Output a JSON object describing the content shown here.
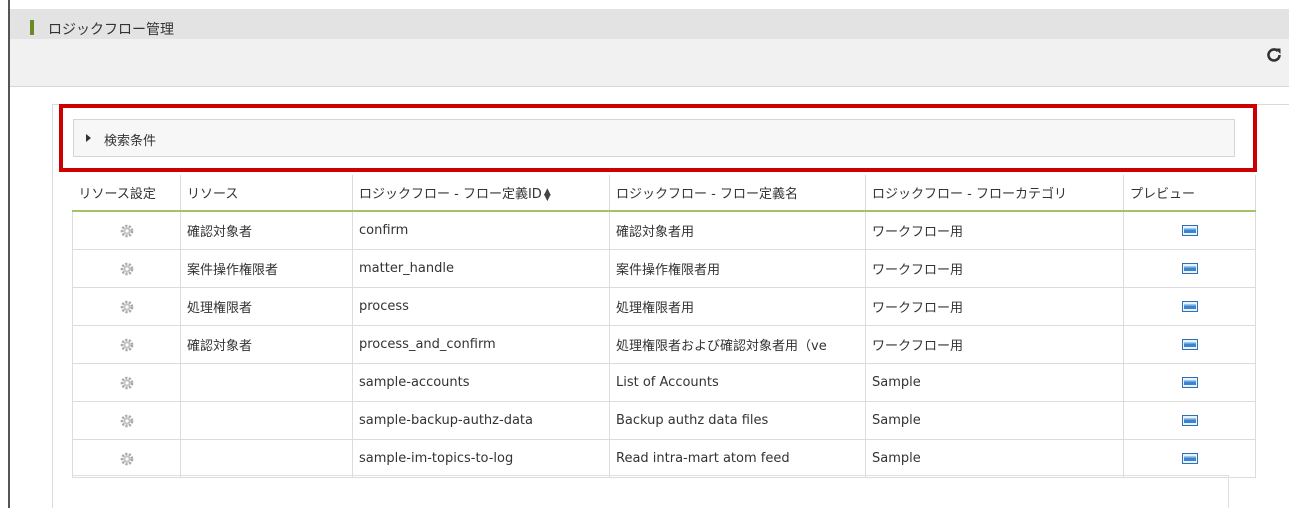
{
  "page": {
    "title": "ロジックフロー管理"
  },
  "search": {
    "label": "検索条件"
  },
  "table": {
    "headers": [
      "リソース設定",
      "リソース",
      "ロジックフロー - フロー定義ID",
      "ロジックフロー - フロー定義名",
      "ロジックフロー - フローカテゴリ",
      "プレビュー"
    ],
    "rows": [
      {
        "resource": "確認対象者",
        "flow_id": "confirm",
        "flow_name": "確認対象者用",
        "category": "ワークフロー用"
      },
      {
        "resource": "案件操作権限者",
        "flow_id": "matter_handle",
        "flow_name": "案件操作権限者用",
        "category": "ワークフロー用"
      },
      {
        "resource": "処理権限者",
        "flow_id": "process",
        "flow_name": "処理権限者用",
        "category": "ワークフロー用"
      },
      {
        "resource": "確認対象者",
        "flow_id": "process_and_confirm",
        "flow_name": "処理権限者および確認対象者用（ve",
        "category": "ワークフロー用"
      },
      {
        "resource": "",
        "flow_id": "sample-accounts",
        "flow_name": "List of Accounts",
        "category": "Sample"
      },
      {
        "resource": "",
        "flow_id": "sample-backup-authz-data",
        "flow_name": "Backup authz data files",
        "category": "Sample"
      },
      {
        "resource": "",
        "flow_id": "sample-im-topics-to-log",
        "flow_name": "Read intra-mart atom feed",
        "category": "Sample"
      }
    ]
  },
  "colors": {
    "highlight": "#cc0000",
    "accent": "#a5c26b",
    "title_marker": "#6a8a2a"
  },
  "icons": {
    "refresh": "refresh-icon",
    "gear": "gear-icon",
    "preview": "preview-icon",
    "search_toggle": "triangle-right-icon"
  }
}
